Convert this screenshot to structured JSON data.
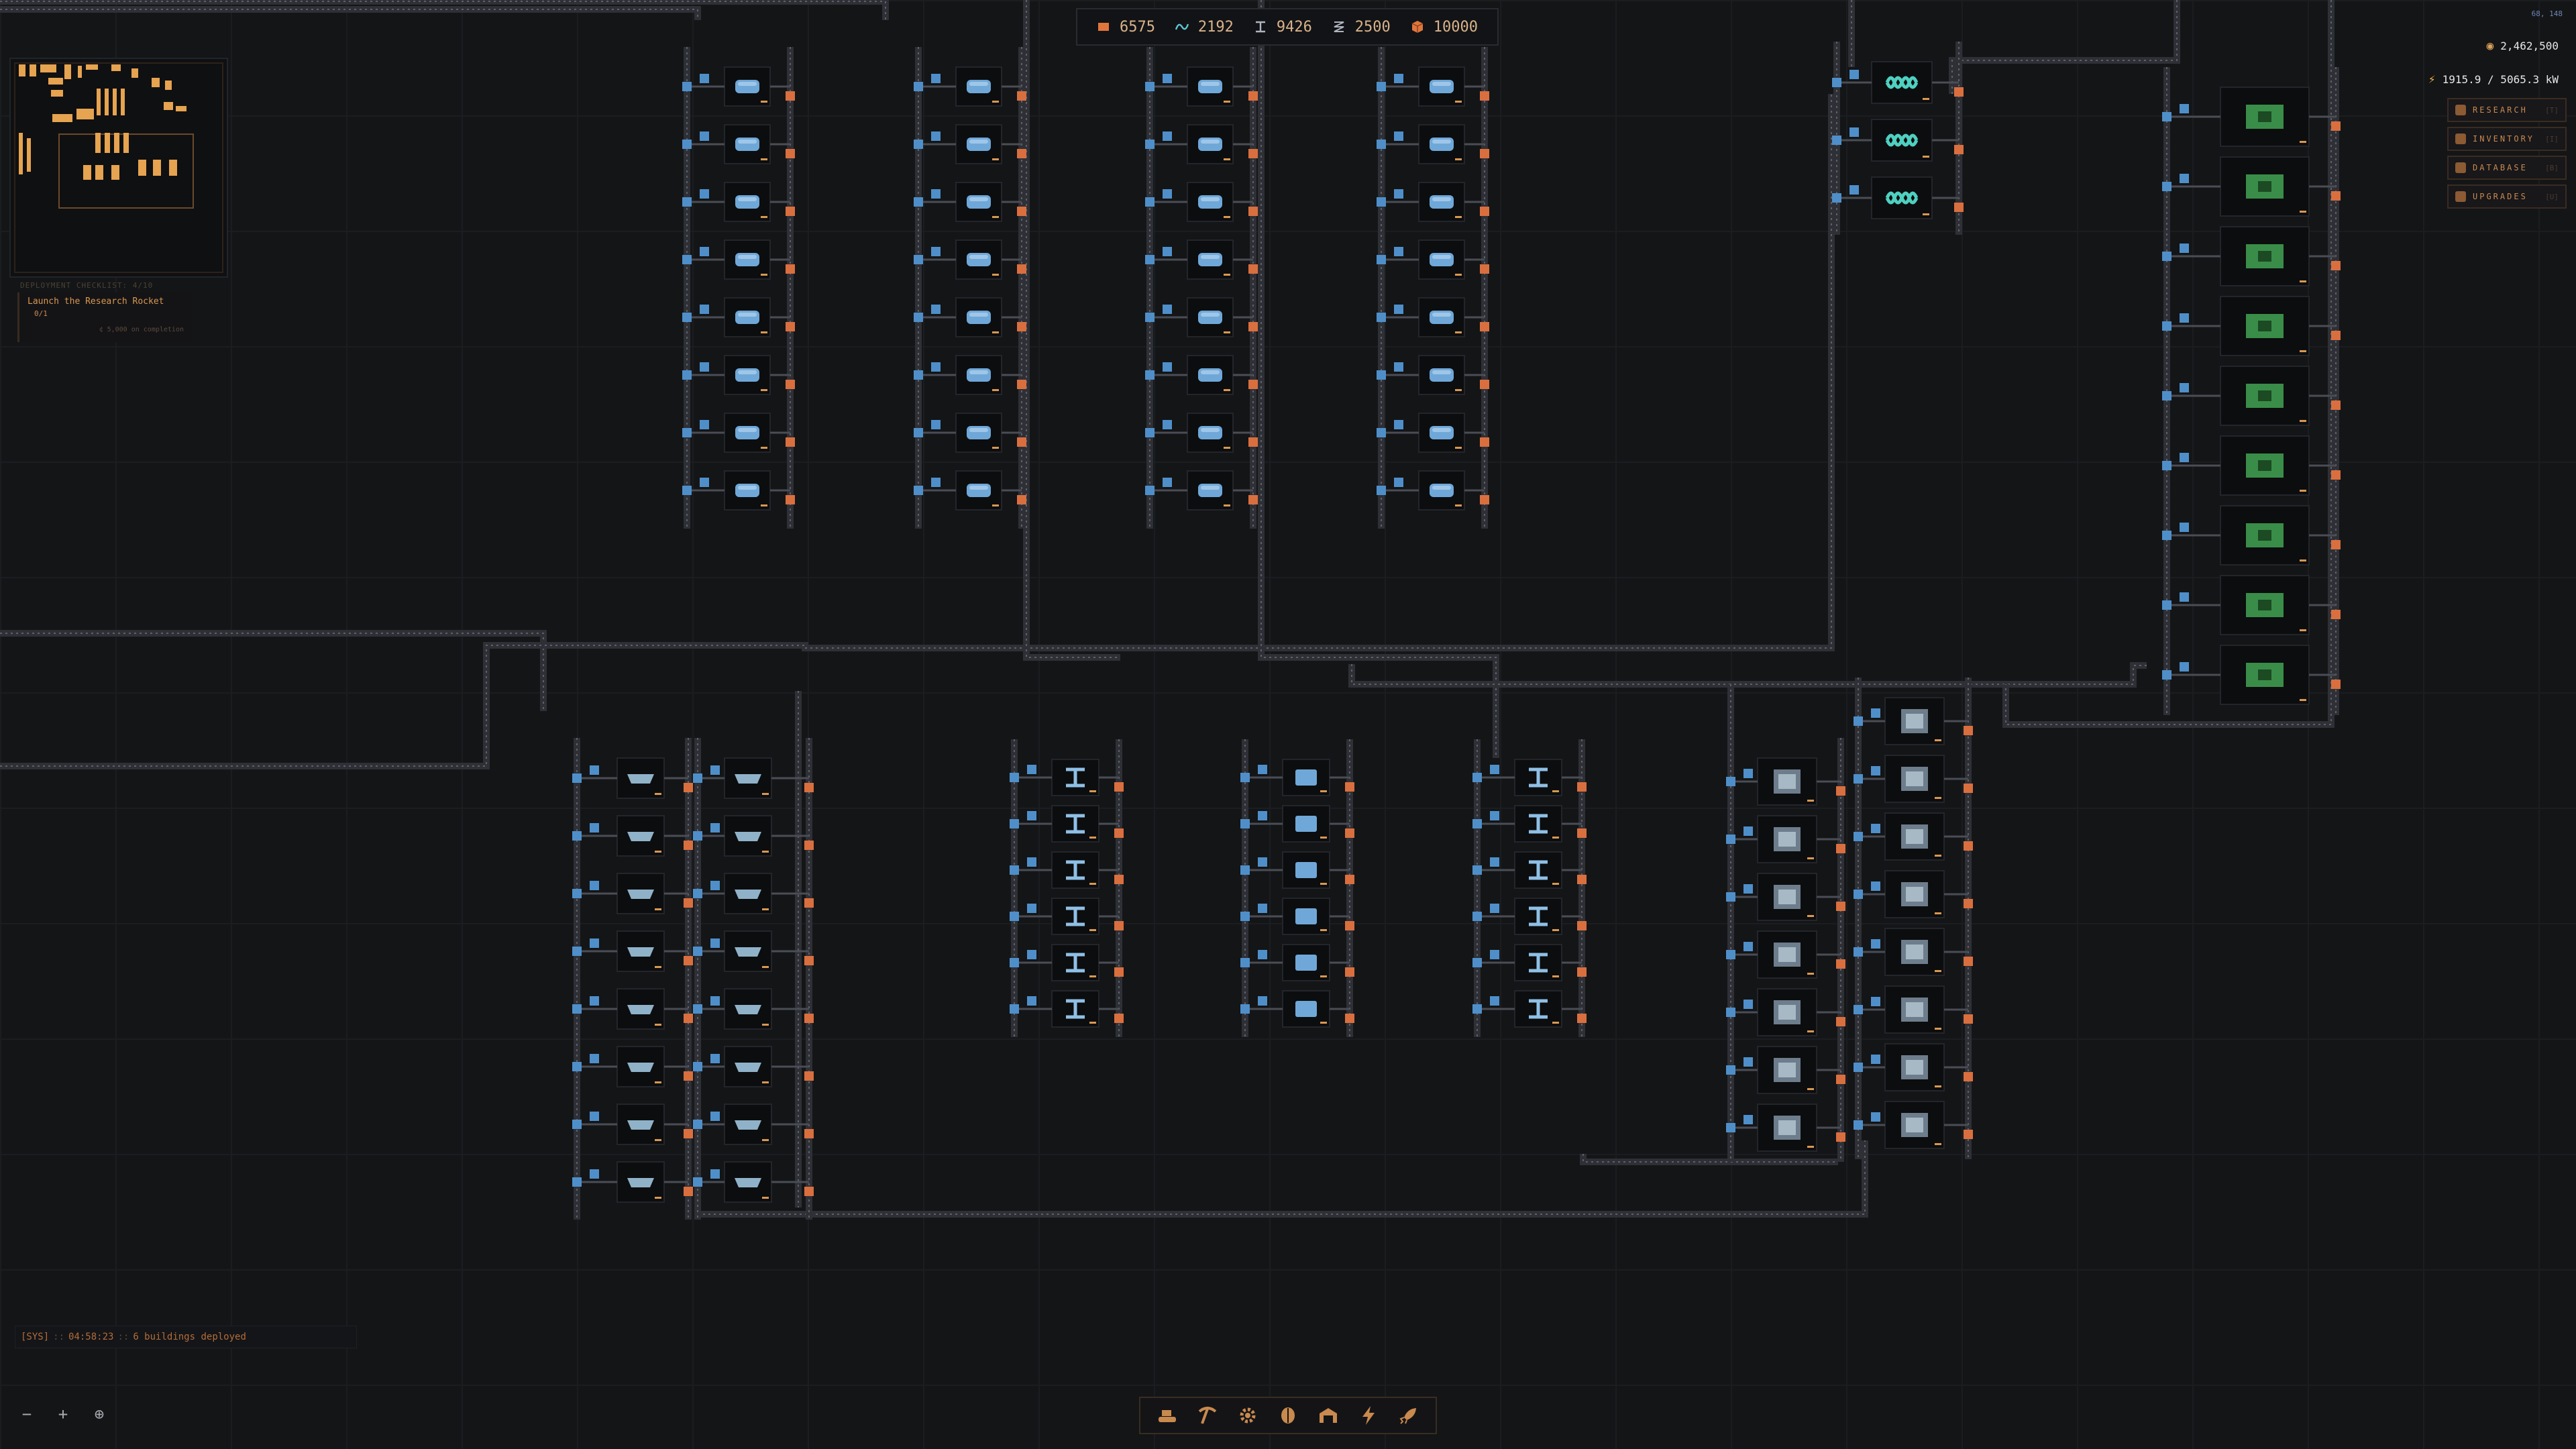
{
  "resources": [
    {
      "name": "ore",
      "icon": "square-icon",
      "value": "6575",
      "color": "#e0763c"
    },
    {
      "name": "wave",
      "icon": "wave-icon",
      "value": "2192",
      "color": "#5ec8d6"
    },
    {
      "name": "beam",
      "icon": "ibeam-icon",
      "value": "9426",
      "color": "#a0a4b0"
    },
    {
      "name": "coil",
      "icon": "coil-icon",
      "value": "2500",
      "color": "#a0a4b0"
    },
    {
      "name": "cube",
      "icon": "cube-icon",
      "value": "10000",
      "color": "#e0763c"
    }
  ],
  "hud": {
    "coords": "68, 148",
    "credits": "2,462,500",
    "power": "1915.9 / 5065.3 kW"
  },
  "menu": [
    {
      "label": "RESEARCH",
      "key": "[T]",
      "icon": "flask-icon"
    },
    {
      "label": "INVENTORY",
      "key": "[I]",
      "icon": "box-icon"
    },
    {
      "label": "DATABASE",
      "key": "[B]",
      "icon": "database-icon"
    },
    {
      "label": "UPGRADES",
      "key": "[U]",
      "icon": "upgrade-icon"
    }
  ],
  "objectives": {
    "header": "DEPLOYMENT CHECKLIST: 4/10",
    "title": "Launch the Research Rocket",
    "progress": "0/1",
    "reward": "¢ 5,000 on completion"
  },
  "log": {
    "tag": "[SYS]",
    "time": "04:58:23",
    "message": "6 buildings deployed"
  },
  "zoom": {
    "out": "−",
    "in": "+",
    "center": "⊕"
  },
  "toolbar": [
    "conveyor-icon",
    "pickaxe-icon",
    "gear-icon",
    "brain-icon",
    "warehouse-icon",
    "lightning-icon",
    "rocket-icon"
  ],
  "colors": {
    "input_port": "#4f8fc9",
    "output_port": "#d96f3f",
    "belt": "#3c3e45",
    "machine": "#0c0d0f",
    "accent": "#d9984f",
    "circuit": "#3a8d48",
    "teal": "#4fd0c0"
  }
}
